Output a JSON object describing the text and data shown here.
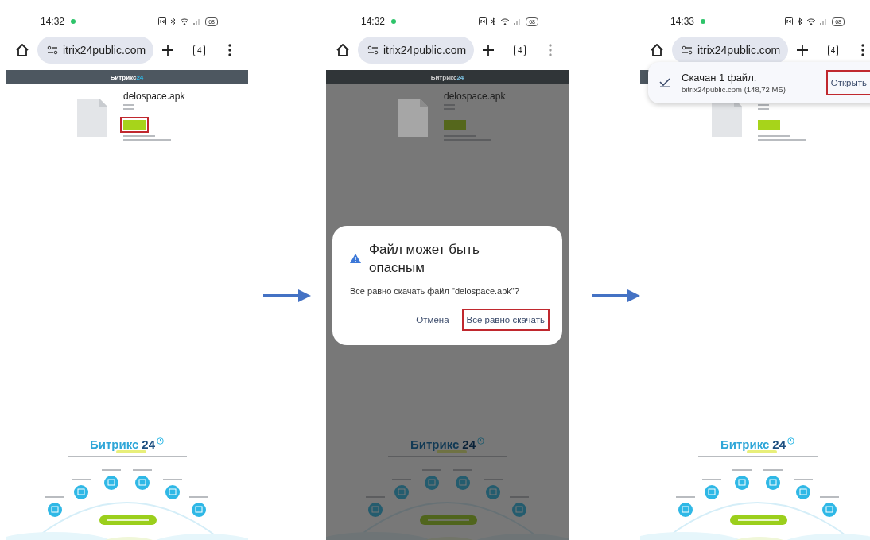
{
  "phones": [
    {
      "status_bar": {
        "time": "14:32",
        "battery": "68"
      },
      "toolbar": {
        "url": "itrix24public.com",
        "tab_count": "4",
        "menu_disabled": false
      },
      "page": {
        "brand": "Битрикс",
        "brand_number": "24",
        "file_name": "delospace.apk",
        "logo": "Битрикс",
        "logo_number": "24"
      },
      "download_marked": true
    },
    {
      "status_bar": {
        "time": "14:32",
        "battery": "68"
      },
      "toolbar": {
        "url": "itrix24public.com",
        "tab_count": "4",
        "menu_disabled": true
      },
      "page": {
        "brand": "Битрикс",
        "brand_number": "24",
        "file_name": "delospace.apk",
        "logo": "Битрикс",
        "logo_number": "24"
      },
      "dimmed": true,
      "download_marked": false,
      "dialog": {
        "title": "Файл может быть опасным",
        "message": "Все равно скачать файл \"delospace.apk\"?",
        "buttons": [
          {
            "label": "Отмена",
            "highlighted": false
          },
          {
            "label": "Все равно скачать",
            "highlighted": true
          }
        ]
      }
    },
    {
      "status_bar": {
        "time": "14:33",
        "battery": "68"
      },
      "toolbar": {
        "url": "itrix24public.com",
        "tab_count": "4",
        "menu_disabled": false
      },
      "page": {
        "logo": "Битрикс",
        "logo_number": "24"
      },
      "download_marked": false,
      "snackbar": {
        "title": "Скачан 1 файл.",
        "detail": "bitrix24public.com (148,72 МБ)",
        "action": "Открыть",
        "action_highlighted": true
      }
    }
  ]
}
